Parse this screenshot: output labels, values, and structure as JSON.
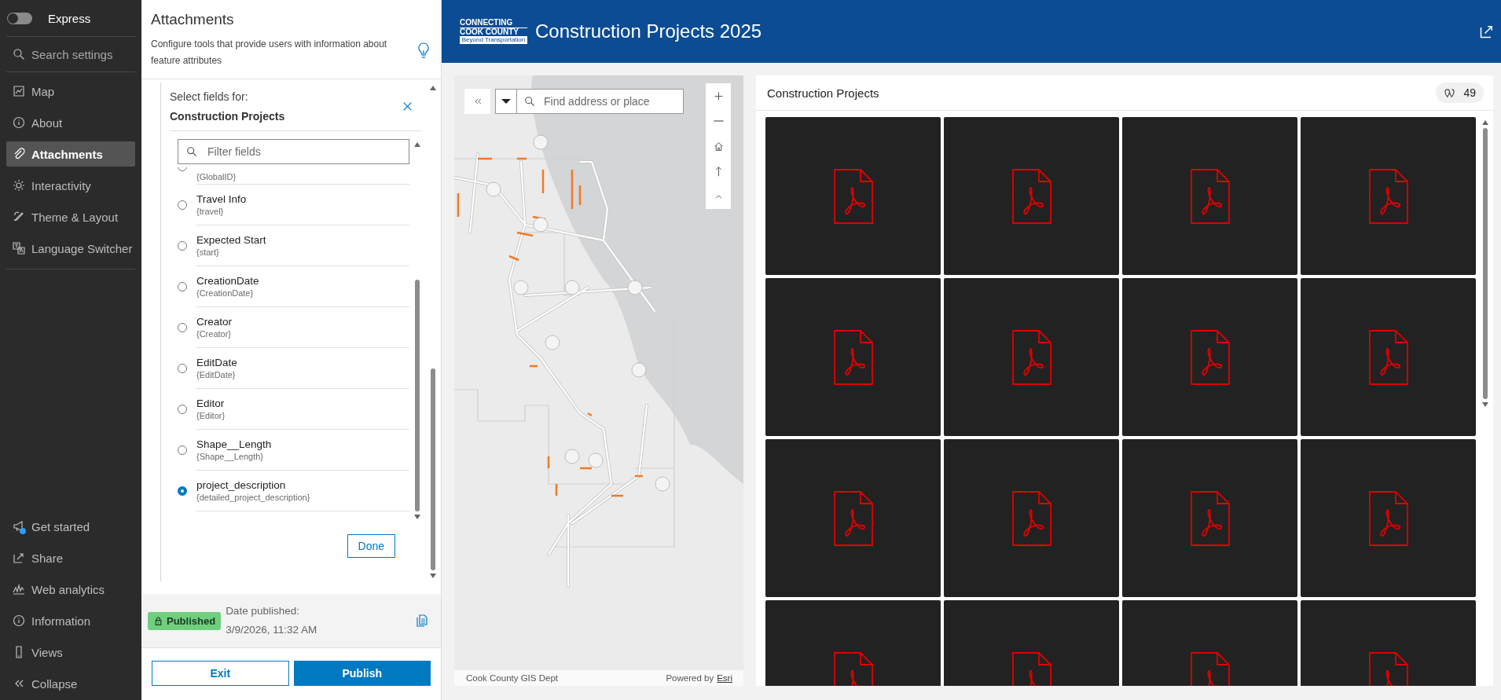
{
  "nav": {
    "express": {
      "label": "Express",
      "on": false
    },
    "search": {
      "placeholder": "Search settings"
    },
    "items": [
      {
        "kind": "map",
        "label": "Map",
        "selected": false
      },
      {
        "kind": "info",
        "label": "About",
        "selected": false
      },
      {
        "kind": "clip",
        "label": "Attachments",
        "selected": true
      },
      {
        "kind": "gear",
        "label": "Interactivity",
        "selected": false
      },
      {
        "kind": "brush",
        "label": "Theme & Layout",
        "selected": false
      },
      {
        "kind": "lang",
        "label": "Language Switcher",
        "selected": false
      }
    ],
    "bottom_items": [
      {
        "kind": "megaphone",
        "label": "Get started",
        "notification": true
      },
      {
        "kind": "share",
        "label": "Share",
        "notification": false
      },
      {
        "kind": "chart",
        "label": "Web analytics",
        "notification": false
      },
      {
        "kind": "info",
        "label": "Information",
        "notification": false
      },
      {
        "kind": "phone",
        "label": "Views",
        "notification": false
      },
      {
        "kind": "collapse",
        "label": "Collapse",
        "notification": false
      }
    ]
  },
  "settings": {
    "title": "Attachments",
    "description": "Configure tools that provide users with information about feature attributes",
    "picker": {
      "heading": "Select fields for:",
      "layer": "Construction Projects",
      "filter": {
        "placeholder": "Filter fields"
      },
      "fields": [
        {
          "field": "{GlobalID}",
          "selected": false
        },
        {
          "name": "Travel Info",
          "field": "{travel}",
          "selected": false
        },
        {
          "name": "Expected Start",
          "field": "{start}",
          "selected": false
        },
        {
          "name": "CreationDate",
          "field": "{CreationDate}",
          "selected": false
        },
        {
          "name": "Creator",
          "field": "{Creator}",
          "selected": false
        },
        {
          "name": "EditDate",
          "field": "{EditDate}",
          "selected": false
        },
        {
          "name": "Editor",
          "field": "{Editor}",
          "selected": false
        },
        {
          "name": "Shape__Length",
          "field": "{Shape__Length}",
          "selected": false
        },
        {
          "name": "project_description",
          "field": "{detailed_project_description}",
          "selected": true
        }
      ],
      "done": "Done"
    },
    "status": {
      "badge": "Published",
      "date_label": "Date published:",
      "date": "3/9/2026, 11:32 AM"
    },
    "buttons": {
      "exit": "Exit",
      "publish": "Publish"
    }
  },
  "header": {
    "logo": [
      "CONNECTING",
      "COOK COUNTY",
      "Beyond Transportation"
    ],
    "title": "Construction Projects 2025"
  },
  "map": {
    "search": {
      "placeholder": "Find address or place"
    },
    "attribution": "Cook County GIS Dept",
    "powered_by": "Powered by",
    "powered_link": "Esri"
  },
  "gallery": {
    "title": "Construction Projects",
    "count": "49",
    "items": [
      {
        "kind": "pdf"
      },
      {
        "kind": "pdf"
      },
      {
        "kind": "pdf"
      },
      {
        "kind": "pdf"
      },
      {
        "kind": "pdf"
      },
      {
        "kind": "pdf"
      },
      {
        "kind": "pdf"
      },
      {
        "kind": "pdf"
      },
      {
        "kind": "pdf"
      },
      {
        "kind": "pdf"
      },
      {
        "kind": "pdf"
      },
      {
        "kind": "pdf"
      },
      {
        "kind": "pdf"
      },
      {
        "kind": "pdf"
      },
      {
        "kind": "pdf"
      },
      {
        "kind": "pdf"
      }
    ]
  }
}
